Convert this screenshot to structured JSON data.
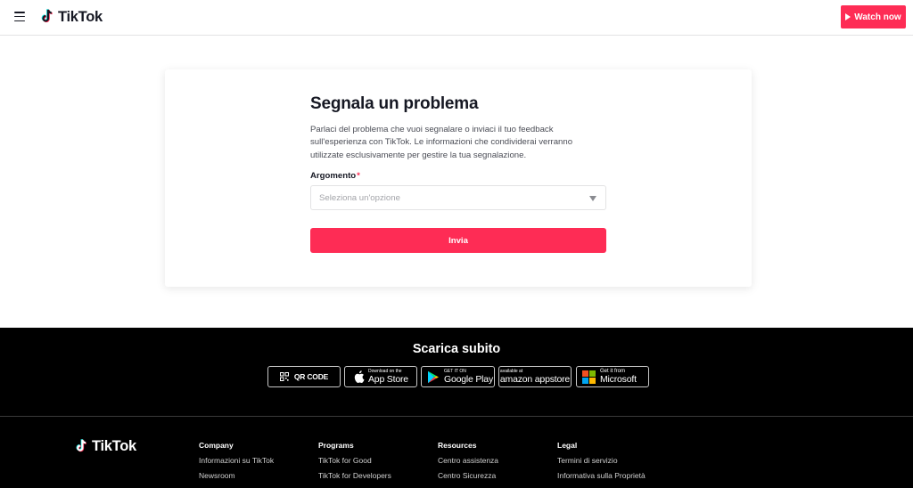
{
  "header": {
    "brand": "TikTok",
    "watch_label": "Watch now"
  },
  "form": {
    "title": "Segnala un problema",
    "description": "Parlaci del problema che vuoi segnalare o inviaci il tuo feedback sull'esperienza con TikTok. Le informazioni che condividerai verranno utilizzate esclusivamente per gestire la tua segnalazione.",
    "topic_label": "Argomento",
    "required_mark": "*",
    "topic_placeholder": "Seleziona un'opzione",
    "submit_label": "Invia"
  },
  "download": {
    "title": "Scarica subito",
    "qr_label": "QR CODE",
    "apple_small": "Download on the",
    "apple_big": "App Store",
    "google_small": "GET IT ON",
    "google_big": "Google Play",
    "amazon_small": "available at",
    "amazon_big": "amazon appstore",
    "ms_small": "Get it from",
    "ms_big": "Microsoft"
  },
  "footer": {
    "brand": "TikTok",
    "columns": [
      {
        "heading": "Company",
        "links": [
          "Informazioni su TikTok",
          "Newsroom"
        ]
      },
      {
        "heading": "Programs",
        "links": [
          "TikTok for Good",
          "TikTok for Developers"
        ]
      },
      {
        "heading": "Resources",
        "links": [
          "Centro assistenza",
          "Centro Sicurezza"
        ]
      },
      {
        "heading": "Legal",
        "links": [
          "Termini di servizio",
          "Informativa sulla Proprietà"
        ]
      }
    ]
  },
  "colors": {
    "accent": "#fe2c55",
    "footer_bg": "#000000",
    "text_primary": "#161823"
  }
}
